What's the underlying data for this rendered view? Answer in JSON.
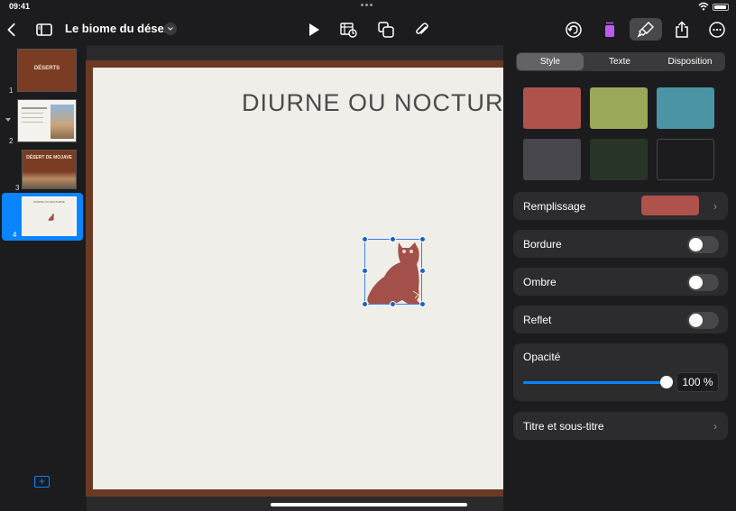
{
  "status": {
    "time": "09:41"
  },
  "document": {
    "title": "Le biome du désert"
  },
  "toolbar": {
    "icons": [
      "back-chevron-icon",
      "sidebar-icon",
      "play-icon",
      "table-chart-icon",
      "shapes-icon",
      "attachment-icon",
      "undo-icon",
      "animate-icon",
      "format-brush-icon",
      "share-icon",
      "more-icon"
    ],
    "accent_animate": "#bf5af2"
  },
  "navigator": {
    "slides": [
      {
        "number": "1",
        "title": "DÉSERTS"
      },
      {
        "number": "2",
        "title": ""
      },
      {
        "number": "3",
        "title": "DÉSERT DE MOJAVE"
      },
      {
        "number": "4",
        "title": "DIURNE OU NOCTURNE"
      }
    ],
    "selected_slide": "4"
  },
  "slide": {
    "title": "DIURNE OU NOCTURNE",
    "object": "owl-shape",
    "object_color": "#a4504a"
  },
  "inspector": {
    "tabs": [
      {
        "label": "Style",
        "selected": true
      },
      {
        "label": "Texte",
        "selected": false
      },
      {
        "label": "Disposition",
        "selected": false
      }
    ],
    "swatches": [
      "#b0524c",
      "#9aa85a",
      "#4a94a4",
      "#46464c",
      "#283428",
      "#1c1c1e"
    ],
    "fill": {
      "label": "Remplissage",
      "color": "#b0524c"
    },
    "border": {
      "label": "Bordure",
      "on": false
    },
    "shadow": {
      "label": "Ombre",
      "on": false
    },
    "reflection": {
      "label": "Reflet",
      "on": false
    },
    "opacity": {
      "label": "Opacité",
      "value": "100 %",
      "fraction": 1.0
    },
    "title_subtitle": {
      "label": "Titre et sous-titre"
    }
  }
}
